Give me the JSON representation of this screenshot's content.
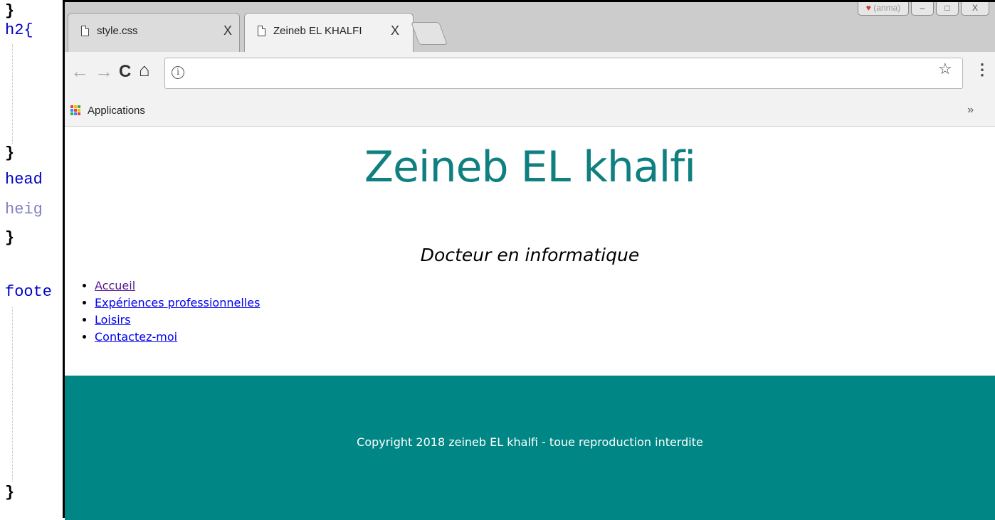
{
  "editor": {
    "lines": [
      {
        "text": "}"
      },
      {
        "text": "h2{"
      },
      {
        "text": "}"
      },
      {
        "text": "head"
      },
      {
        "text": "heig"
      },
      {
        "text": "}"
      },
      {
        "text": "foote"
      },
      {
        "text": "}"
      }
    ]
  },
  "browser": {
    "tabs": [
      {
        "title": "style.css",
        "close": "X"
      },
      {
        "title": "Zeineb EL KHALFI",
        "close": "X"
      }
    ],
    "profile_label": "(anma)",
    "window_controls": [
      "–",
      "□",
      "X"
    ],
    "toolbar": {
      "back_icon": "←",
      "forward_icon": "→",
      "reload_icon": "C",
      "home_icon": "⌂",
      "info_icon": "i",
      "url": "",
      "star_icon": "☆",
      "menu_icon": "⋮"
    },
    "bookmarks": {
      "apps_label": "Applications",
      "apps_colors": [
        "#e94235",
        "#fbbc05",
        "#34a853",
        "#4285f4",
        "#e94235",
        "#fbbc05",
        "#34a853",
        "#4285f4",
        "#e94235"
      ],
      "more": "»"
    }
  },
  "page": {
    "title": "Zeineb EL khalfi",
    "title_color": "#0f7f80",
    "subtitle": "Docteur en informatique",
    "nav": [
      {
        "label": "Accueil",
        "visited": true
      },
      {
        "label": "Expériences professionnelles",
        "visited": false
      },
      {
        "label": "Loisirs",
        "visited": false
      },
      {
        "label": "Contactez-moi",
        "visited": false
      }
    ],
    "link_color": "#0000ee",
    "visited_link_color": "#551a8b",
    "footer": {
      "text": "Copyright 2018 zeineb EL khalfi - toue reproduction interdite",
      "background": "#008785"
    }
  }
}
